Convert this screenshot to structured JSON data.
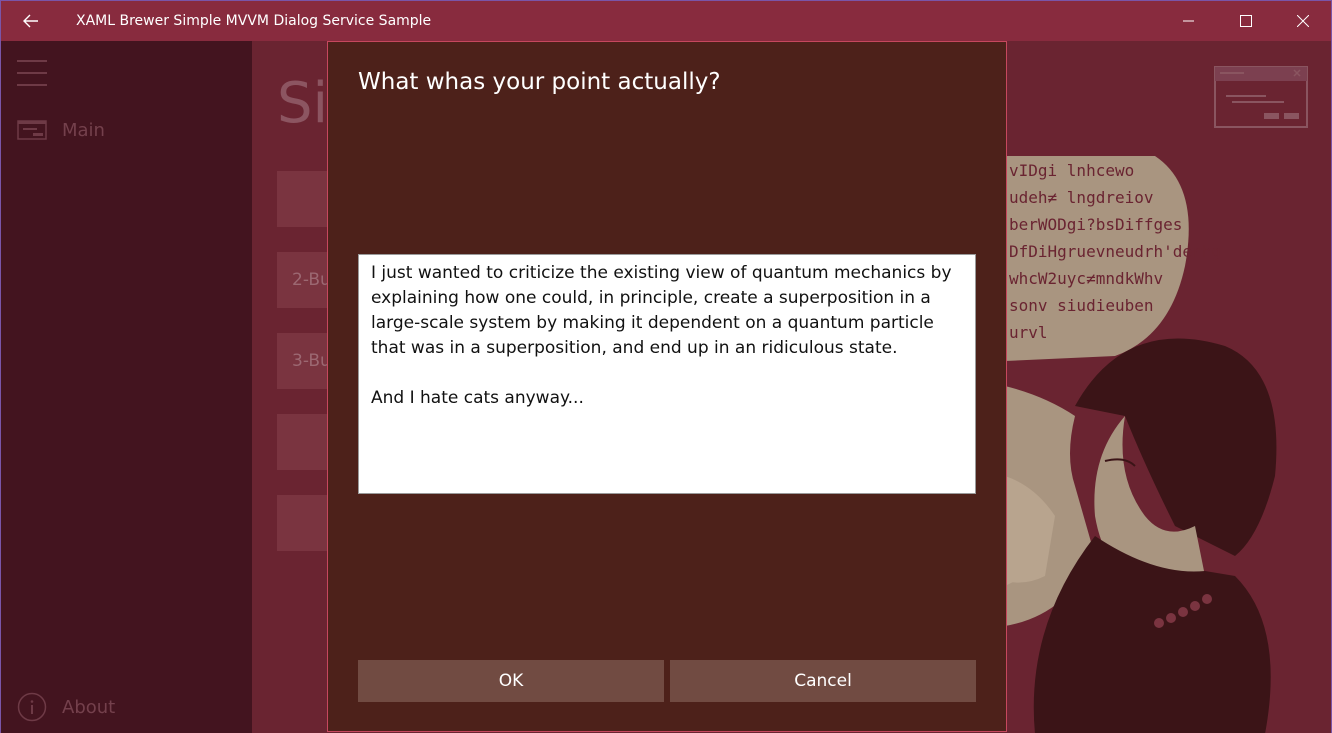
{
  "window": {
    "title": "XAML Brewer Simple MVVM Dialog Service Sample",
    "icons": {
      "back": "back-arrow-icon",
      "minimize": "minimize-icon",
      "maximize": "maximize-icon",
      "close": "close-icon"
    }
  },
  "nav": {
    "items": [
      {
        "label": "Main",
        "icon": "dialog-window-icon"
      },
      {
        "label": "About",
        "icon": "info-icon"
      }
    ]
  },
  "main": {
    "title_partial": "Si",
    "buttons": [
      {
        "label": ""
      },
      {
        "label": "2-Bu"
      },
      {
        "label": "3-Bu"
      },
      {
        "label": ""
      },
      {
        "label": ""
      }
    ],
    "speech_bubble_text": "vIDgi lnhcewo\nudeh≠ lngdreiov\nberWODgi?bsDiffges\nDfDiHgruevneudrh'derhg\nwhcW2uyc≠mndkWhv\nsonv siudieuben\nurvl"
  },
  "dialog": {
    "title": "What whas your point actually?",
    "text": "I just wanted to criticize the existing view of quantum mechanics by explaining how one could, in principle, create a superposition in a large-scale system by making it dependent on a quantum particle that was in a superposition, and end up in an ridiculous state.\n\nAnd I hate cats anyway...",
    "ok_label": "OK",
    "cancel_label": "Cancel"
  },
  "colors": {
    "accent": "#882b3e",
    "dialog_bg": "#4d211a",
    "dialog_border": "#c6485e",
    "button_bg": "#714b42",
    "nav_bg": "#43141f"
  }
}
